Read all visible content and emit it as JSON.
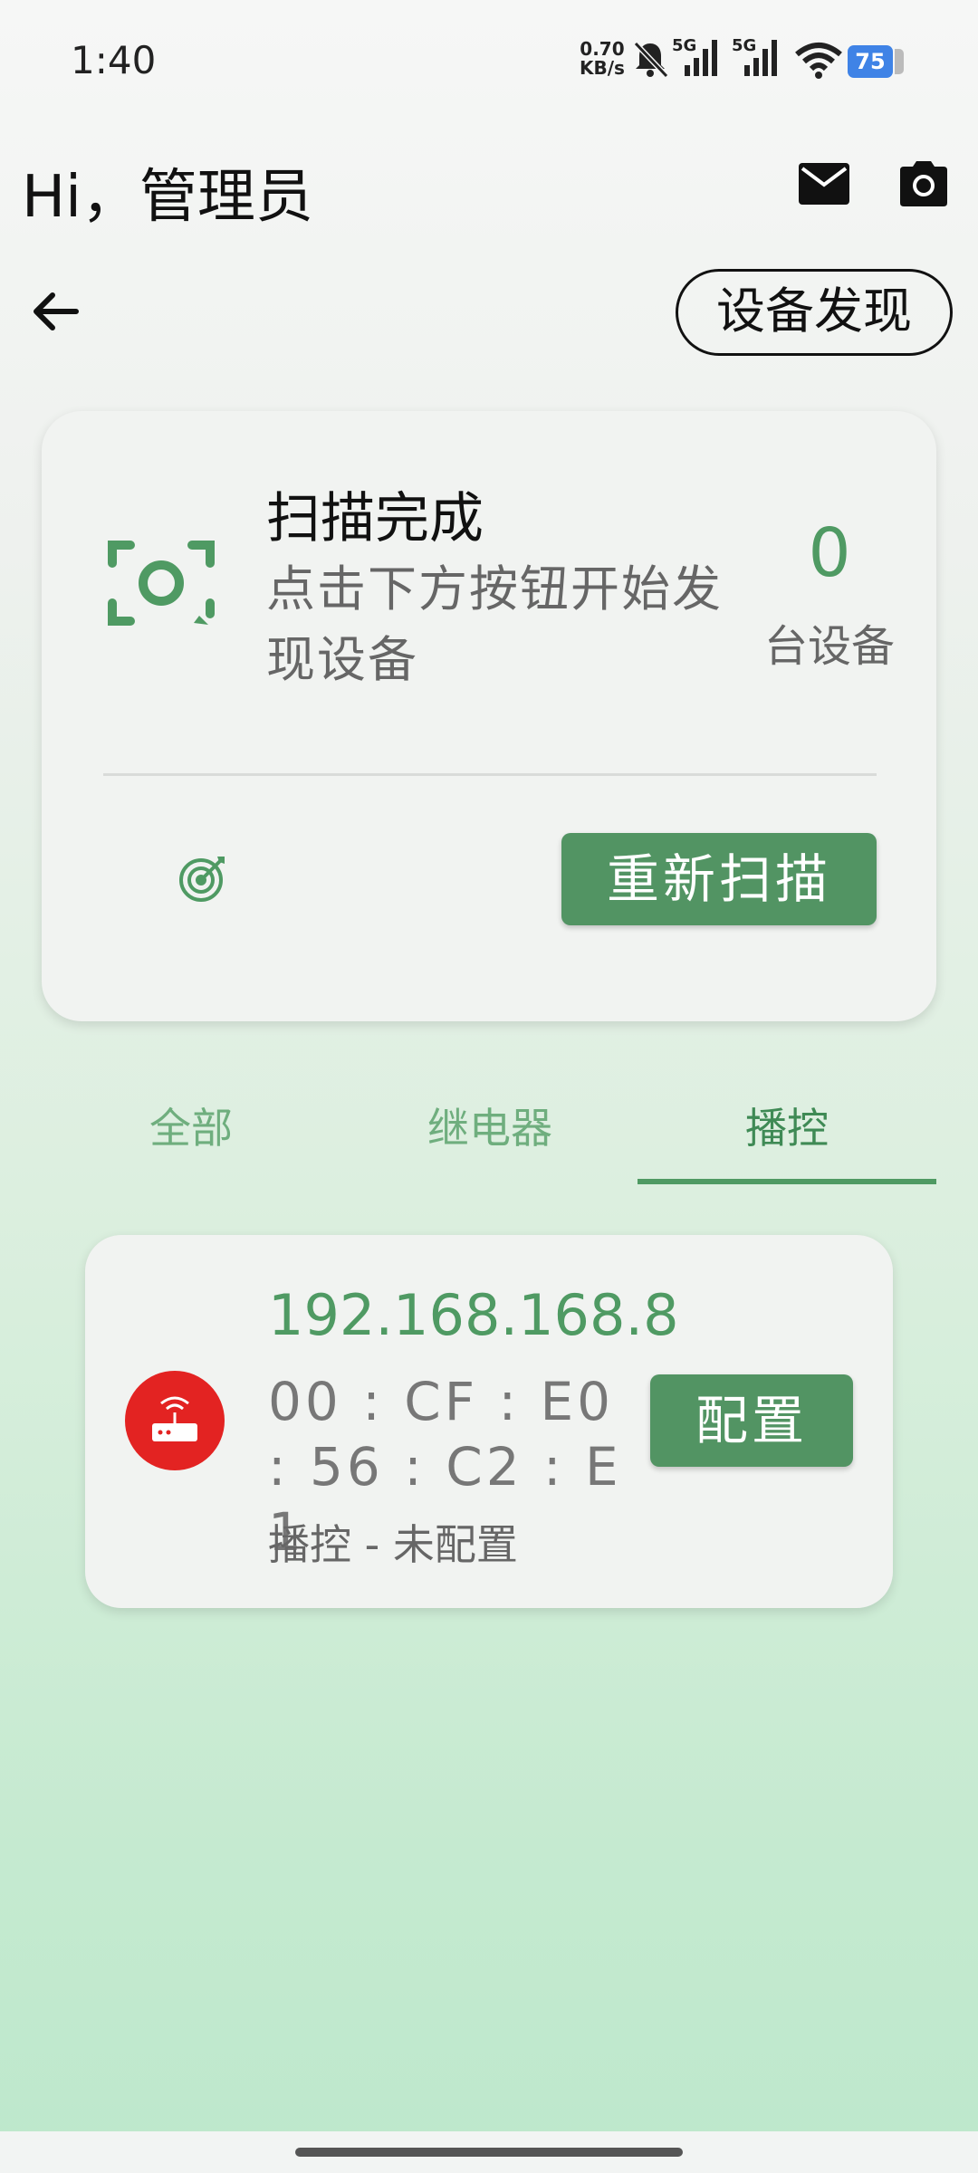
{
  "status_bar": {
    "time": "1:40",
    "net_speed_value": "0.70",
    "net_speed_unit": "KB/s",
    "signal1_label": "5G",
    "signal2_label": "5G",
    "battery": "75"
  },
  "header": {
    "greeting": "Hi，管理员"
  },
  "nav": {
    "title": "设备发现"
  },
  "scan_card": {
    "title": "扫描完成",
    "description": "点击下方按钮开始发现设备",
    "count": "0",
    "count_label": "台设备",
    "rescan_label": "重新扫描"
  },
  "tabs": [
    {
      "label": "全部",
      "active": false
    },
    {
      "label": "继电器",
      "active": false
    },
    {
      "label": "播控",
      "active": true
    }
  ],
  "devices": [
    {
      "ip": "192.168.168.8",
      "mac": "00:CF:E0:56:C2:E1",
      "mac_display": "00 : CF : E0 : 56 : C2 : E1",
      "status": "播控 - 未配置",
      "action_label": "配置"
    }
  ],
  "colors": {
    "accent": "#529463",
    "accent_text": "#4f9a63",
    "device_icon_bg": "#e32322",
    "battery": "#3f83e6"
  }
}
